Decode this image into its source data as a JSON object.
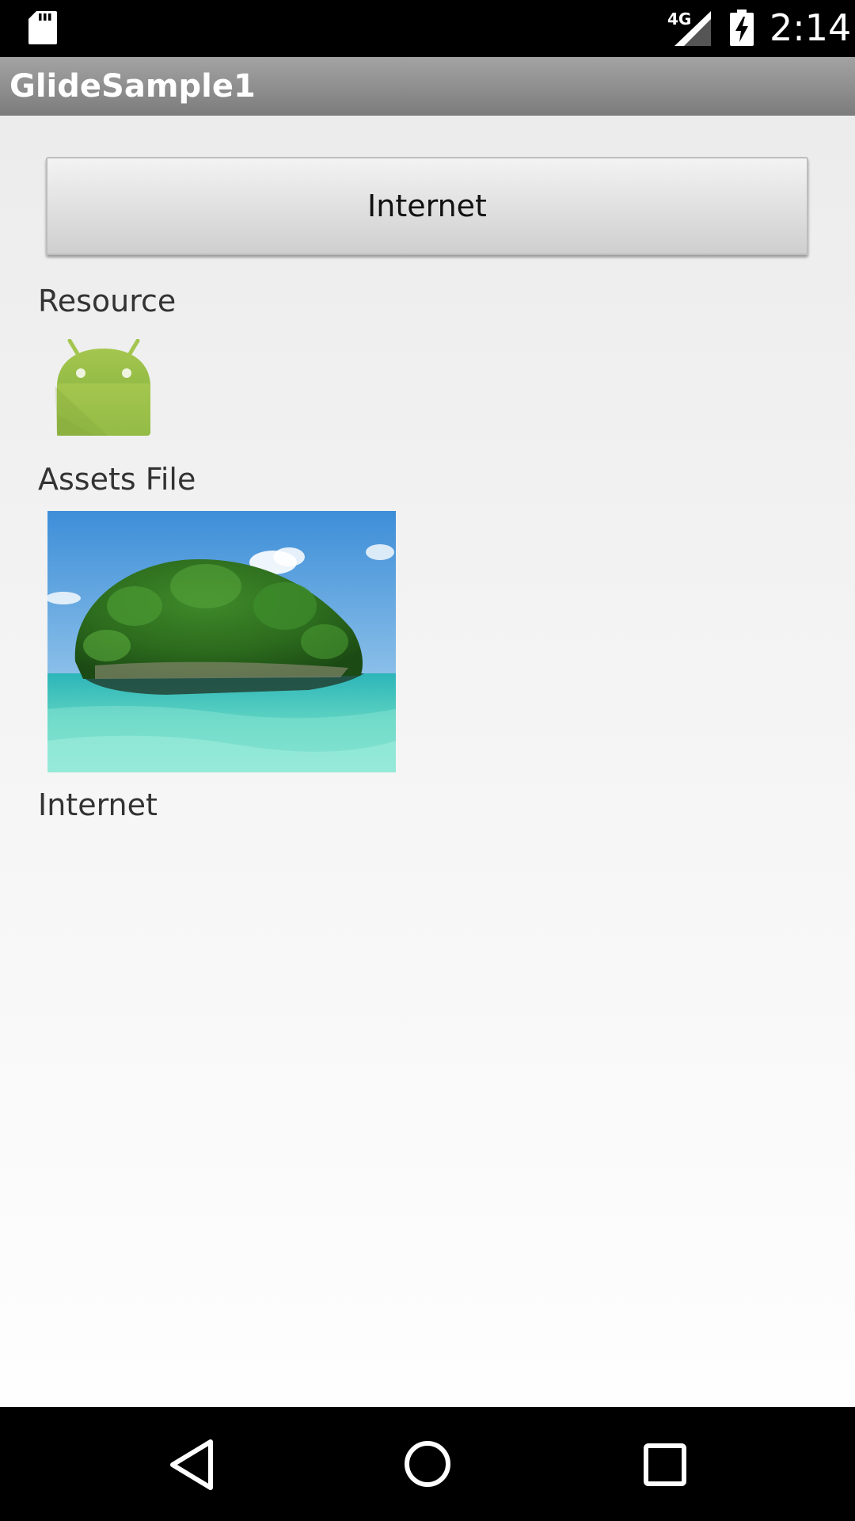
{
  "status_bar": {
    "network_label": "4G",
    "time": "2:14",
    "icons": [
      "sd-card-icon",
      "signal-icon",
      "battery-charging-icon"
    ]
  },
  "app_bar": {
    "title": "GlideSample1",
    "color": "#8f8f8f"
  },
  "main": {
    "internet_button_label": "Internet",
    "sections": [
      {
        "label": "Resource",
        "image": "android-robot-icon"
      },
      {
        "label": "Assets File",
        "image": "island-photo"
      },
      {
        "label": "Internet"
      }
    ]
  },
  "nav_bar": {
    "icons": [
      "back-icon",
      "home-icon",
      "recents-icon"
    ]
  },
  "colors": {
    "android_green": "#9bc34b",
    "background": "#efefef"
  }
}
